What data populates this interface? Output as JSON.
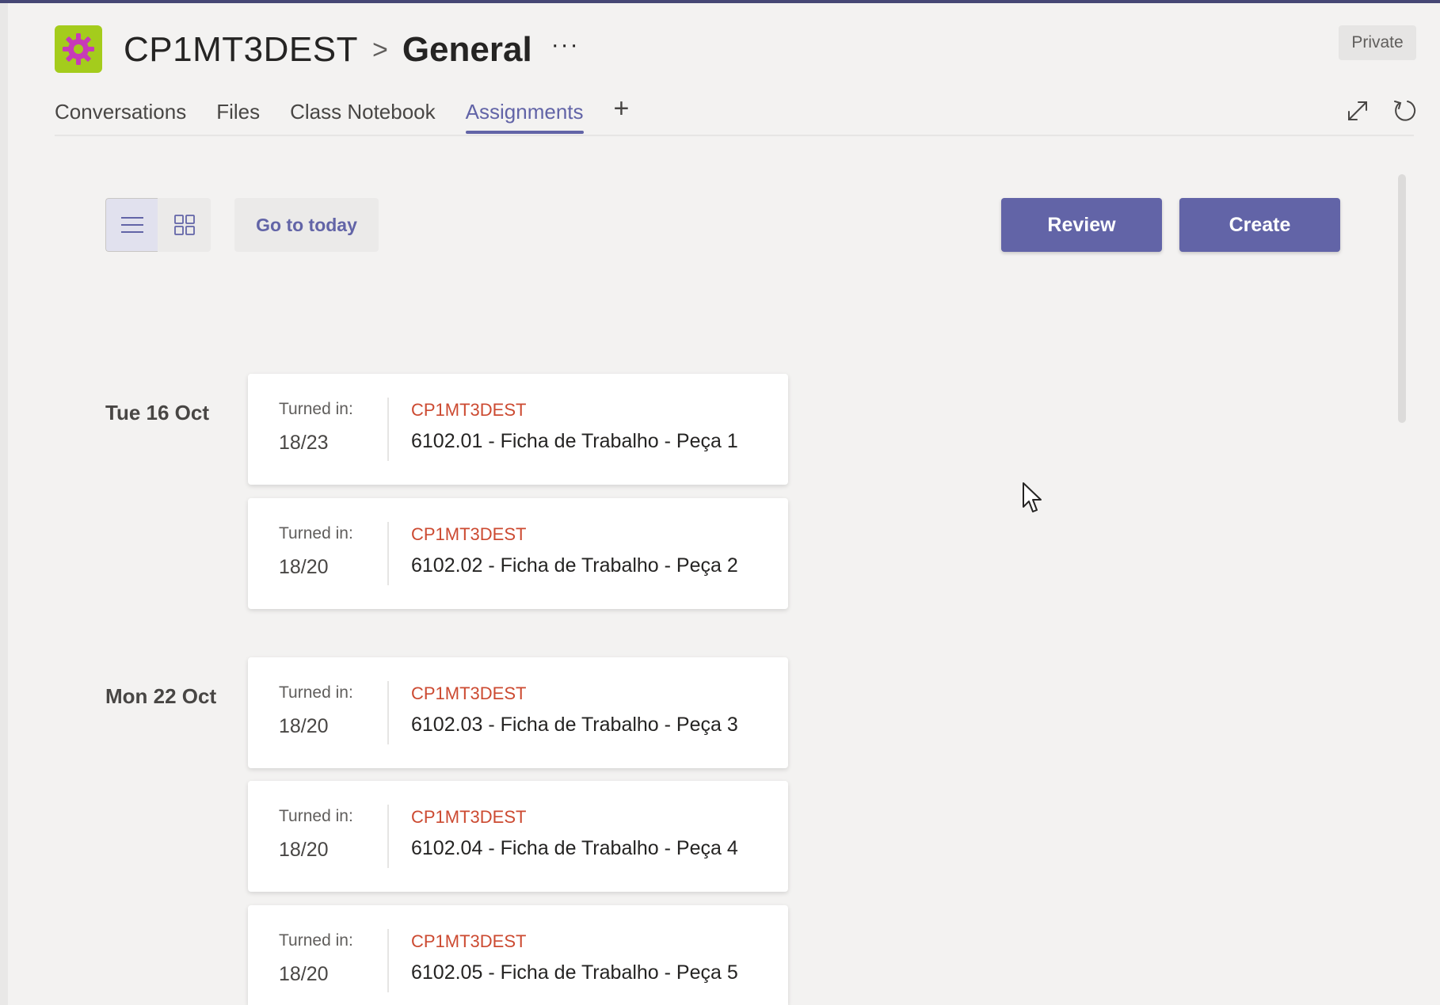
{
  "header": {
    "team_name": "CP1MT3DEST",
    "separator": ">",
    "channel_name": "General",
    "more": "···",
    "privacy_badge": "Private",
    "logo_color": "#a4cc1c",
    "logo_icon": "gear-icon"
  },
  "tabs": [
    {
      "label": "Conversations",
      "active": false
    },
    {
      "label": "Files",
      "active": false
    },
    {
      "label": "Class Notebook",
      "active": false
    },
    {
      "label": "Assignments",
      "active": true
    }
  ],
  "tab_add": "+",
  "toolbar": {
    "go_to_today": "Go to today",
    "review": "Review",
    "create": "Create",
    "list_view_icon": "list-view-icon",
    "grid_view_icon": "grid-view-icon"
  },
  "accent_color": "#6264a7",
  "class_label_color": "#cc4a31",
  "assignments": [
    {
      "date": "Tue 16 Oct",
      "items": [
        {
          "turned_label": "Turned in:",
          "count": "18/23",
          "class": "CP1MT3DEST",
          "title": "6102.01 - Ficha de Trabalho - Peça 1"
        },
        {
          "turned_label": "Turned in:",
          "count": "18/20",
          "class": "CP1MT3DEST",
          "title": "6102.02 - Ficha de Trabalho - Peça 2"
        }
      ]
    },
    {
      "date": "Mon 22 Oct",
      "items": [
        {
          "turned_label": "Turned in:",
          "count": "18/20",
          "class": "CP1MT3DEST",
          "title": "6102.03 - Ficha de Trabalho - Peça 3"
        },
        {
          "turned_label": "Turned in:",
          "count": "18/20",
          "class": "CP1MT3DEST",
          "title": "6102.04 - Ficha de Trabalho - Peça 4"
        },
        {
          "turned_label": "Turned in:",
          "count": "18/20",
          "class": "CP1MT3DEST",
          "title": "6102.05 - Ficha de Trabalho - Peça 5"
        }
      ]
    }
  ]
}
